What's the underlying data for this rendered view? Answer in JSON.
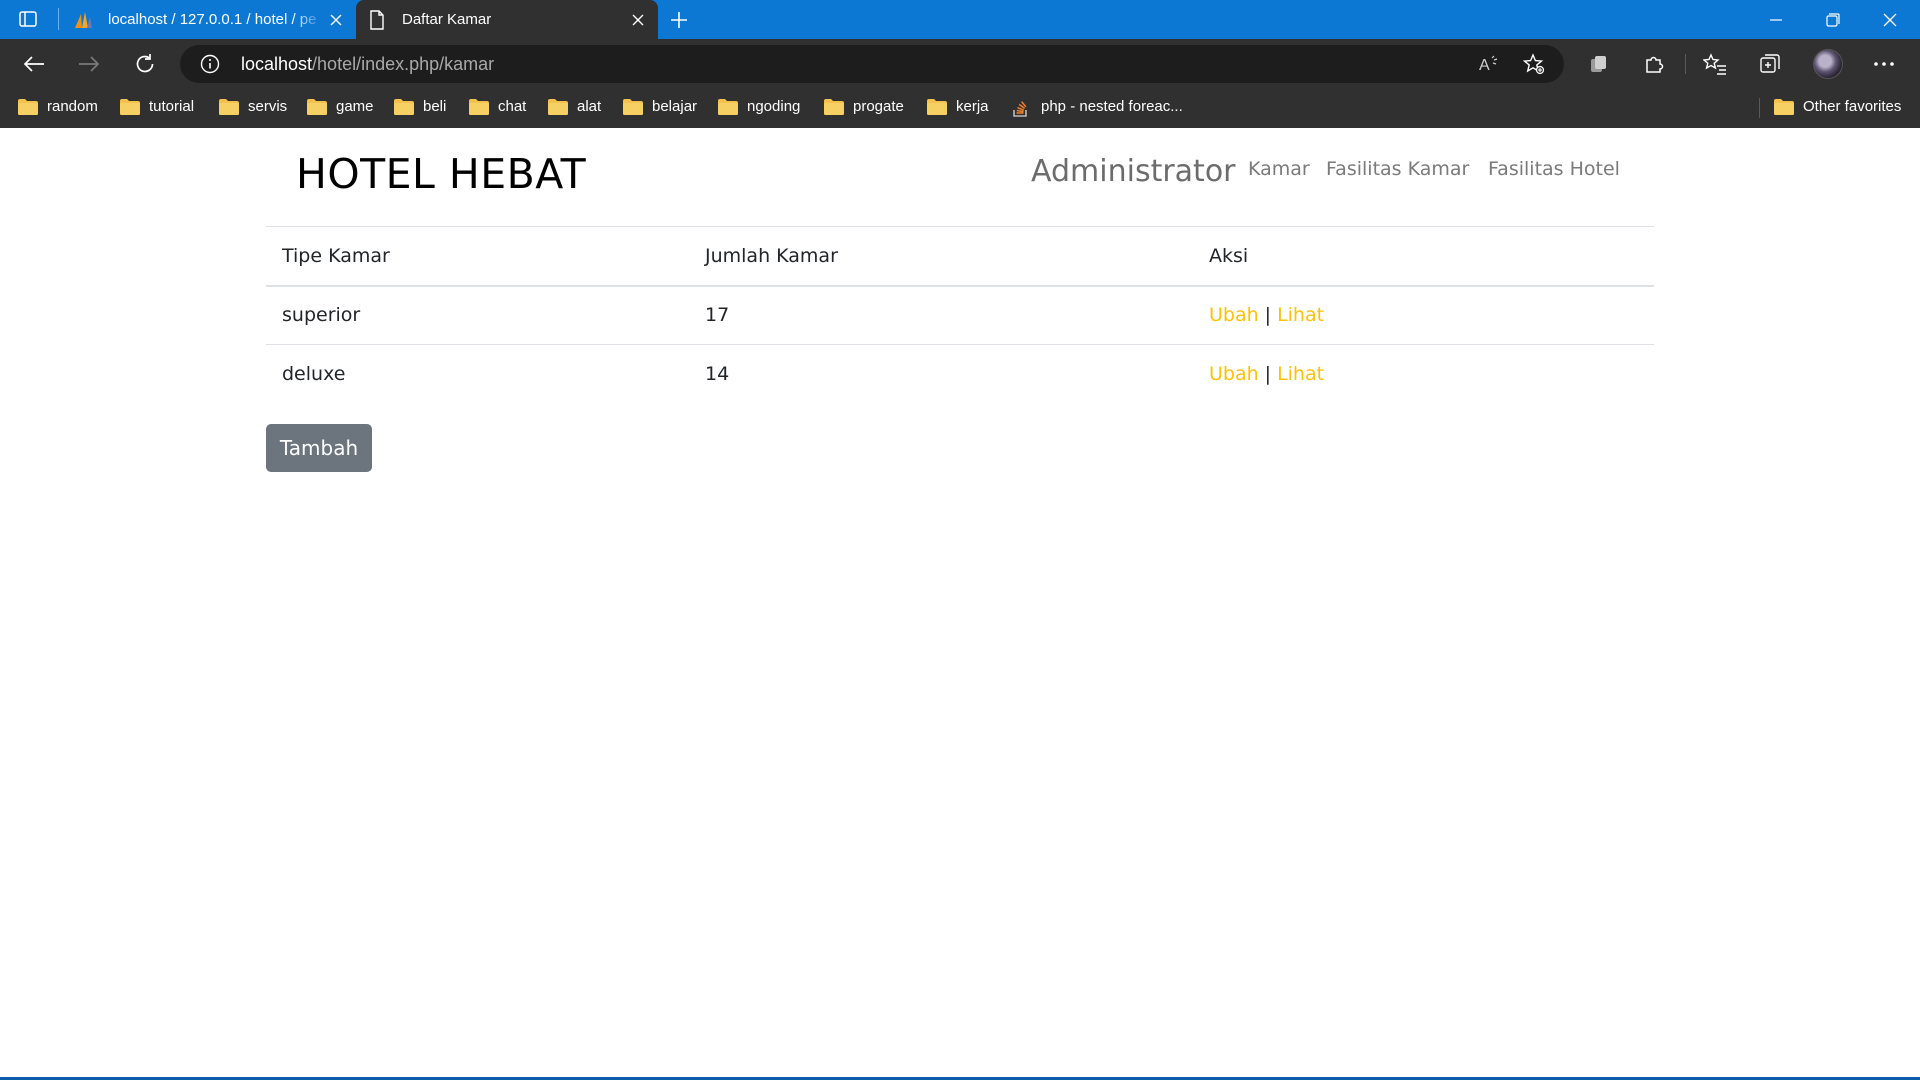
{
  "browser": {
    "tabs": [
      {
        "title": "localhost / 127.0.0.1 / hotel / pe",
        "active": false
      },
      {
        "title": "Daftar Kamar",
        "active": true
      }
    ],
    "address": {
      "host": "localhost",
      "path": "/hotel/index.php/kamar"
    },
    "bookmarks": [
      "random",
      "tutorial",
      "servis",
      "game",
      "beli",
      "chat",
      "alat",
      "belajar",
      "ngoding",
      "progate",
      "kerja",
      "php - nested foreac..."
    ],
    "other_favorites": "Other favorites",
    "colors": {
      "titlebar": "#0c78d4",
      "toolbar": "#303030",
      "folder": "#f2c14e"
    }
  },
  "page": {
    "brand": "HOTEL HEBAT",
    "nav": {
      "admin": "Administrator",
      "kamar": "Kamar",
      "fasilitas_kamar": "Fasilitas Kamar",
      "fasilitas_hotel": "Fasilitas Hotel"
    },
    "table": {
      "headers": [
        "Tipe Kamar",
        "Jumlah Kamar",
        "Aksi"
      ],
      "rows": [
        {
          "tipe": "superior",
          "jumlah": "17",
          "ubah": "Ubah",
          "sep": "|",
          "lihat": "Lihat"
        },
        {
          "tipe": "deluxe",
          "jumlah": "14",
          "ubah": "Ubah",
          "sep": "|",
          "lihat": "Lihat"
        }
      ]
    },
    "add_button": "Tambah",
    "colors": {
      "action_link": "#ffc107",
      "button": "#6c757d"
    }
  }
}
